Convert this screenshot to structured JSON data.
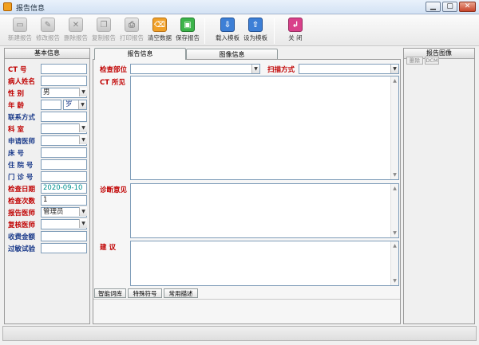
{
  "window": {
    "title": "报告信息",
    "min": "▁",
    "max": "▢",
    "close": "✕"
  },
  "toolbar": [
    {
      "id": "new",
      "label": "新建报告",
      "icon": "new-document-icon",
      "enabled": false
    },
    {
      "id": "edit",
      "label": "修改报告",
      "icon": "edit-pencil-icon",
      "enabled": false
    },
    {
      "id": "delete",
      "label": "删除报告",
      "icon": "delete-x-icon",
      "enabled": false
    },
    {
      "id": "copy",
      "label": "复制报告",
      "icon": "copy-icon",
      "enabled": false
    },
    {
      "id": "print",
      "label": "打印报告",
      "icon": "printer-icon",
      "enabled": false
    },
    {
      "id": "clear",
      "label": "清空数据",
      "icon": "clear-data-icon",
      "enabled": true,
      "color": "#f0a028"
    },
    {
      "id": "save",
      "label": "保存报告",
      "icon": "save-icon",
      "enabled": true,
      "color": "#3cb44a"
    },
    {
      "id": "load_template",
      "label": "载入模板",
      "icon": "load-template-icon",
      "enabled": true,
      "color": "#3d7fd6"
    },
    {
      "id": "set_template",
      "label": "设为模板",
      "icon": "set-template-icon",
      "enabled": true,
      "color": "#3d7fd6"
    },
    {
      "id": "close",
      "label": "关 闭",
      "icon": "exit-icon",
      "enabled": true,
      "color": "#d9408a"
    }
  ],
  "left_panel": {
    "title": "基本信息",
    "fields": [
      {
        "label": "CT   号",
        "value": "",
        "type": "text",
        "color": "red"
      },
      {
        "label": "病人姓名",
        "value": "",
        "type": "text",
        "color": "red"
      },
      {
        "label": "性    别",
        "value": "男",
        "type": "select",
        "color": "red"
      },
      {
        "label": "年    龄",
        "value": "",
        "unit": "岁",
        "type": "age",
        "color": "red"
      },
      {
        "label": "联系方式",
        "value": "",
        "type": "text",
        "color": "blue"
      },
      {
        "label": "科    室",
        "value": "",
        "type": "select",
        "color": "red"
      },
      {
        "label": "申请医师",
        "value": "",
        "type": "select",
        "color": "blue"
      },
      {
        "label": "床    号",
        "value": "",
        "type": "text",
        "color": "blue"
      },
      {
        "label": "住 院 号",
        "value": "",
        "type": "text",
        "color": "blue"
      },
      {
        "label": "门 诊 号",
        "value": "",
        "type": "text",
        "color": "blue"
      },
      {
        "label": "检查日期",
        "value": "2020-09-10",
        "type": "date",
        "color": "red"
      },
      {
        "label": "检查次数",
        "value": "1",
        "type": "text",
        "color": "red"
      },
      {
        "label": "报告医师",
        "value": "管理员",
        "type": "select",
        "color": "red"
      },
      {
        "label": "复核医师",
        "value": "",
        "type": "select",
        "color": "red"
      },
      {
        "label": "收费金额",
        "value": "",
        "type": "text",
        "color": "blue"
      },
      {
        "label": "过敏试验",
        "value": "",
        "type": "text",
        "color": "blue"
      }
    ]
  },
  "center": {
    "tabs": [
      "报告信息",
      "图像信息"
    ],
    "exam_part_label": "检查部位",
    "scan_method_label": "扫描方式",
    "ct_findings_label": "CT 所见",
    "diagnosis_label": "诊断意见",
    "advice_label": "建    议",
    "bottom_tabs": [
      "智能词库",
      "特殊符号",
      "常用描述"
    ]
  },
  "right_panel": {
    "title": "报告图像",
    "buttons": [
      "删除",
      "DCM"
    ]
  }
}
